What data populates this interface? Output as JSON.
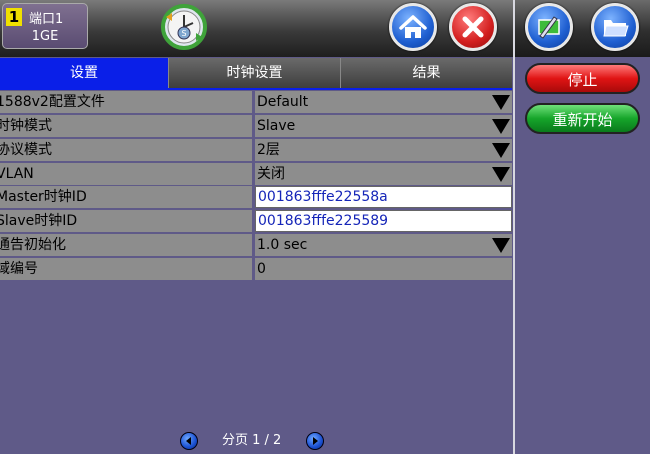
{
  "header": {
    "port_number": "1",
    "port_label": "端口1",
    "port_speed": "1GE",
    "icons": [
      "clock-sync-icon",
      "home-icon",
      "close-icon",
      "tools-icon",
      "folder-icon"
    ]
  },
  "tabs": [
    {
      "label": "设置",
      "active": true
    },
    {
      "label": "时钟设置",
      "active": false
    },
    {
      "label": "结果",
      "active": false
    }
  ],
  "settings": [
    {
      "label": "1588v2配置文件",
      "value": "Default",
      "dropdown": true
    },
    {
      "label": "时钟模式",
      "value": "Slave",
      "dropdown": true
    },
    {
      "label": "协议模式",
      "value": "2层",
      "dropdown": true
    },
    {
      "label": "VLAN",
      "value": "关闭",
      "dropdown": true
    },
    {
      "label": "Master时钟ID",
      "value": "001863fffe22558a",
      "dropdown": false
    },
    {
      "label": "Slave时钟ID",
      "value": "001863fffe225589",
      "dropdown": false
    },
    {
      "label": "通告初始化",
      "value": "1.0 sec",
      "dropdown": true
    },
    {
      "label": "域编号",
      "value": "0",
      "dropdown": false
    }
  ],
  "actions": {
    "stop_label": "停止",
    "restart_label": "重新开始"
  },
  "pager": {
    "text": "分页 1 / 2"
  },
  "colors": {
    "background": "#5f5a88",
    "active_tab": "#0a1fe8",
    "stop": "#e01414",
    "restart": "#16a52a",
    "id_text": "#1525b8"
  }
}
